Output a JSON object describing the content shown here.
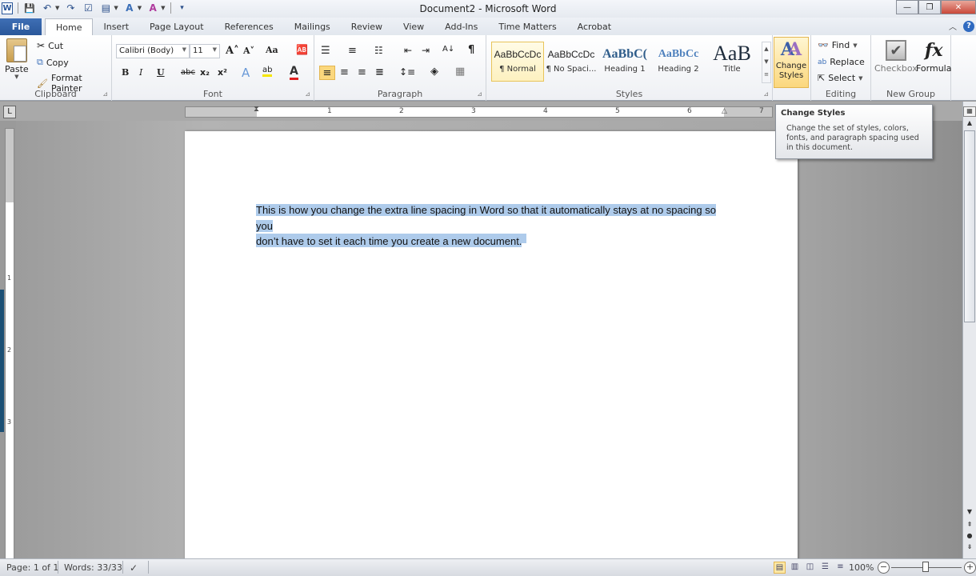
{
  "window": {
    "title": "Document2  -  Microsoft Word",
    "minimize": "—",
    "restore": "❐",
    "close": "✕"
  },
  "qat": {
    "app_icon": "W",
    "save_icon": "💾",
    "undo_icon": "↶",
    "redo_icon": "↷",
    "checkbox_icon": "☑",
    "new_doc_icon": "▤",
    "text_effect_icon": "A",
    "highlight_icon": "A",
    "customize_icon": "▾"
  },
  "tabs": [
    {
      "label": "File"
    },
    {
      "label": "Home"
    },
    {
      "label": "Insert"
    },
    {
      "label": "Page Layout"
    },
    {
      "label": "References"
    },
    {
      "label": "Mailings"
    },
    {
      "label": "Review"
    },
    {
      "label": "View"
    },
    {
      "label": "Add-Ins"
    },
    {
      "label": "Time Matters"
    },
    {
      "label": "Acrobat"
    }
  ],
  "ribbon_right": {
    "minimize_ribbon": "︿",
    "help": "?"
  },
  "clipboard": {
    "label": "Clipboard",
    "paste": "Paste",
    "cut": "Cut",
    "copy": "Copy",
    "format_painter": "Format Painter"
  },
  "font": {
    "label": "Font",
    "family": "Calibri (Body)",
    "size": "11",
    "grow": "A˄",
    "shrink": "A˅",
    "change_case": "Aa",
    "clear_format": "🆎",
    "bold": "B",
    "italic": "I",
    "underline": "U",
    "strikethrough": "abc",
    "subscript": "x₂",
    "superscript": "x²",
    "text_effects": "A",
    "highlight": "ab",
    "font_color": "A",
    "font_color_hex": "#e02020"
  },
  "paragraph": {
    "label": "Paragraph",
    "bullets": "☰",
    "numbering": "≡",
    "multilevel": "☷",
    "decrease_indent": "⇤",
    "increase_indent": "⇥",
    "sort": "A↓",
    "show_marks": "¶",
    "align_left": "≡",
    "center": "≡",
    "align_right": "≡",
    "justify": "≡",
    "line_spacing": "↕≡",
    "shading": "◈",
    "borders": "▦"
  },
  "styles": {
    "label": "Styles",
    "items": [
      {
        "preview": "AaBbCcDc",
        "name": "¶ Normal",
        "selected": true
      },
      {
        "preview": "AaBbCcDc",
        "name": "¶ No Spaci...",
        "selected": false
      },
      {
        "preview": "AaBbC(",
        "name": "Heading 1",
        "selected": false
      },
      {
        "preview": "AaBbCc",
        "name": "Heading 2",
        "selected": false
      },
      {
        "preview": "AaB",
        "name": "Title",
        "selected": false
      }
    ],
    "change_styles": "Change Styles",
    "change_styles_line1": "Change",
    "change_styles_line2": "Styles"
  },
  "editing": {
    "label": "Editing",
    "find": "Find",
    "replace": "Replace",
    "select": "Select"
  },
  "new_group": {
    "label": "New Group",
    "checkbox": "Checkbox",
    "formula": "Formula",
    "formula_icon": "fx"
  },
  "tooltip": {
    "title": "Change Styles",
    "body": "Change the set of styles, colors, fonts, and paragraph spacing used in this document."
  },
  "ruler": {
    "h_numbers": [
      "1",
      "1",
      "2",
      "3",
      "4",
      "5",
      "6",
      "7"
    ],
    "v_numbers": [
      "1",
      "2",
      "3"
    ],
    "tab_selector": "L"
  },
  "document": {
    "line1": "This is  how you change the extra line spacing in Word so that it automatically stays at no spacing so you",
    "line2": "don’t have to set it  each time you create a new document."
  },
  "statusbar": {
    "page": "Page: 1 of 1",
    "words": "Words: 33/33",
    "proofing_icon": "✓",
    "zoom": "100%",
    "zoom_level_percent": 100,
    "zoom_out": "−",
    "zoom_in": "+"
  }
}
